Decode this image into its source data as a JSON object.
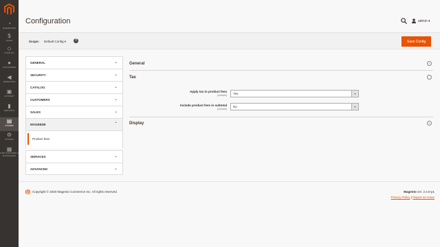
{
  "sidebar": {
    "items": [
      {
        "label": "Dashboard",
        "icon": "dashboard-icon",
        "glyph": "◔"
      },
      {
        "label": "Sales",
        "icon": "dollar-icon",
        "glyph": "$"
      },
      {
        "label": "Catalog",
        "icon": "cube-icon",
        "glyph": "◇"
      },
      {
        "label": "Customers",
        "icon": "person-icon",
        "glyph": "●"
      },
      {
        "label": "Marketing",
        "icon": "megaphone-icon",
        "glyph": "◀"
      },
      {
        "label": "Content",
        "icon": "content-icon",
        "glyph": "▣"
      },
      {
        "label": "Reports",
        "icon": "bar-chart-icon",
        "glyph": "▮"
      },
      {
        "label": "Stores",
        "icon": "store-icon",
        "glyph": "▤"
      },
      {
        "label": "System",
        "icon": "gear-icon",
        "glyph": "⚙"
      },
      {
        "label": "Find Partners & Extensions",
        "icon": "puzzle-icon",
        "glyph": "▦"
      }
    ],
    "active": "Stores"
  },
  "header": {
    "title": "Configuration",
    "user": "admin ▾"
  },
  "scope": {
    "label": "Scope:",
    "value": "Default Config ▾",
    "help": "?",
    "save_label": "Save Config"
  },
  "tabs": {
    "general": "GENERAL",
    "security": "SECURITY",
    "catalog": "CATALOG",
    "customers": "CUSTOMERS",
    "sales": "SALES",
    "mageb2b": "MAGEB2B",
    "product_fees": "Product fees",
    "services": "SERVICES",
    "advanced": "ADVANCED",
    "chev_down": "⌄",
    "chev_up": "⌃"
  },
  "sections": {
    "general": "General",
    "tax": "Tax",
    "display": "Display"
  },
  "fields": {
    "apply_tax": {
      "label": "Apply tax to product fees",
      "scope": "[website]",
      "value": "Yes"
    },
    "include_fees": {
      "label": "Include product fees in subtotal",
      "scope": "[website]",
      "value": "No"
    }
  },
  "footer": {
    "copyright": "Copyright © 2020 Magento Commerce Inc. All rights reserved.",
    "brand": "Magento",
    "version": " ver. 2.4.0-p1",
    "privacy": "Privacy Policy",
    "separator": " | ",
    "report": "Report an Issue"
  },
  "colors": {
    "accent": "#eb5202",
    "sidebar_bg": "#373330"
  }
}
